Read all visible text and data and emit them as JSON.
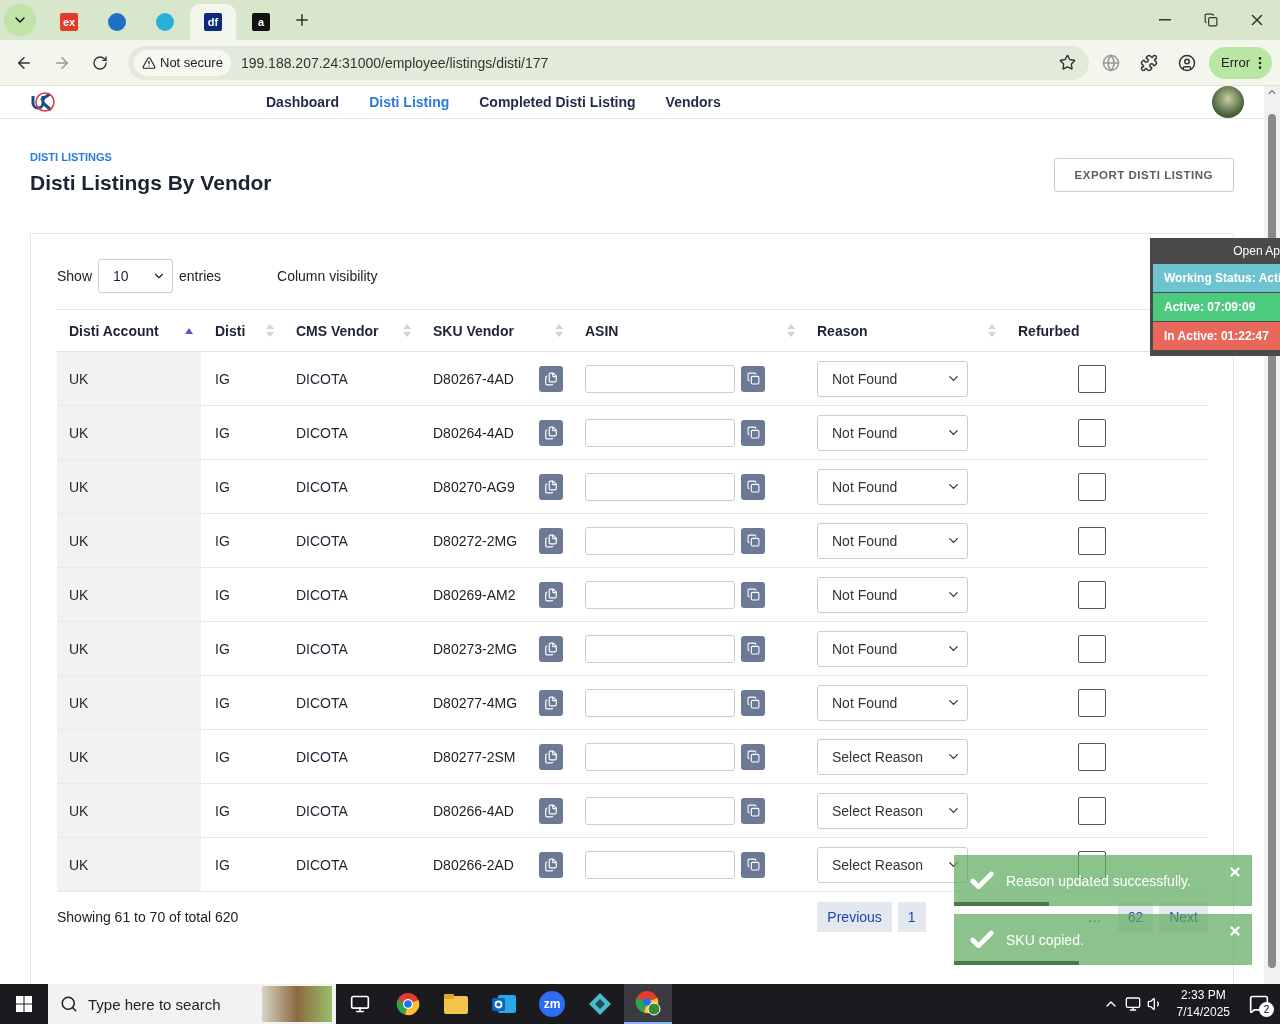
{
  "browser": {
    "tabs": [
      {
        "favicon_text": "ex",
        "selected": false
      },
      {
        "selected": false
      },
      {
        "selected": false
      },
      {
        "favicon_text": "df",
        "selected": true
      },
      {
        "favicon_text": "a",
        "selected": false
      }
    ],
    "security": "Not secure",
    "url": "199.188.207.24:31000/employee/listings/disti/177",
    "profile_button": "Error"
  },
  "nav": {
    "items": [
      {
        "label": "Dashboard",
        "selected": false
      },
      {
        "label": "Disti Listing",
        "selected": true
      },
      {
        "label": "Completed Disti Listing",
        "selected": false
      },
      {
        "label": "Vendors",
        "selected": false
      }
    ]
  },
  "page": {
    "breadcrumb": "DISTI LISTINGS",
    "title": "Disti Listings By Vendor",
    "export_button": "EXPORT DISTI LISTING"
  },
  "table_controls": {
    "show_label": "Show",
    "entries": "10",
    "entries_label": "entries",
    "column_visibility": "Column visibility"
  },
  "table": {
    "columns": [
      {
        "label": "Disti Account",
        "sorted": true
      },
      {
        "label": "Disti",
        "sorted": false
      },
      {
        "label": "CMS Vendor",
        "sorted": false
      },
      {
        "label": "SKU Vendor",
        "sorted": false
      },
      {
        "label": "ASIN",
        "sorted": false
      },
      {
        "label": "Reason",
        "sorted": false
      },
      {
        "label": "Refurbed",
        "sorted": false
      }
    ],
    "rows": [
      {
        "account": "UK",
        "disti": "IG",
        "vendor": "DICOTA",
        "sku": "D80267-4AD",
        "reason": "Not Found",
        "refurbed": false
      },
      {
        "account": "UK",
        "disti": "IG",
        "vendor": "DICOTA",
        "sku": "D80264-4AD",
        "reason": "Not Found",
        "refurbed": false
      },
      {
        "account": "UK",
        "disti": "IG",
        "vendor": "DICOTA",
        "sku": "D80270-AG9",
        "reason": "Not Found",
        "refurbed": false
      },
      {
        "account": "UK",
        "disti": "IG",
        "vendor": "DICOTA",
        "sku": "D80272-2MG",
        "reason": "Not Found",
        "refurbed": false
      },
      {
        "account": "UK",
        "disti": "IG",
        "vendor": "DICOTA",
        "sku": "D80269-AM2",
        "reason": "Not Found",
        "refurbed": false
      },
      {
        "account": "UK",
        "disti": "IG",
        "vendor": "DICOTA",
        "sku": "D80273-2MG",
        "reason": "Not Found",
        "refurbed": false
      },
      {
        "account": "UK",
        "disti": "IG",
        "vendor": "DICOTA",
        "sku": "D80277-4MG",
        "reason": "Not Found",
        "refurbed": false
      },
      {
        "account": "UK",
        "disti": "IG",
        "vendor": "DICOTA",
        "sku": "D80277-2SM",
        "reason": "Select Reason",
        "refurbed": false
      },
      {
        "account": "UK",
        "disti": "IG",
        "vendor": "DICOTA",
        "sku": "D80266-4AD",
        "reason": "Select Reason",
        "refurbed": false
      },
      {
        "account": "UK",
        "disti": "IG",
        "vendor": "DICOTA",
        "sku": "D80266-2AD",
        "reason": "Select Reason",
        "refurbed": false
      }
    ]
  },
  "footer": {
    "summary": "Showing 61 to 70 of total 620",
    "pagination": [
      {
        "label": "Previous",
        "kind": "nav"
      },
      {
        "label": "1",
        "kind": "page"
      },
      {
        "label": "…",
        "kind": "gap"
      },
      {
        "label": "62",
        "kind": "page"
      },
      {
        "label": "Next",
        "kind": "nav"
      }
    ]
  },
  "status_widget": {
    "header": "Open Ap",
    "items": [
      {
        "text": "Working Status: Acti",
        "color": "#6ec3d0"
      },
      {
        "text": "Active: 07:09:09",
        "color": "#4ccb7e"
      },
      {
        "text": "In Active: 01:22:47",
        "color": "#e8685c"
      }
    ]
  },
  "toasts": [
    {
      "message": "Reason updated successfully.",
      "level": 0.32
    },
    {
      "message": "SKU copied.",
      "level": 0.42
    }
  ],
  "taskbar": {
    "search_placeholder": "Type here to search",
    "apps": [
      {
        "kind": "taskview",
        "selected": false
      },
      {
        "kind": "chrome",
        "selected": false
      },
      {
        "kind": "folder",
        "selected": false
      },
      {
        "kind": "mail",
        "selected": false
      },
      {
        "kind": "video",
        "text": "zm",
        "selected": false
      },
      {
        "kind": "diamond",
        "selected": false
      },
      {
        "kind": "chrome-profile",
        "selected": true
      }
    ],
    "time": "2:33 PM",
    "date": "7/14/2025",
    "notifications": "2"
  }
}
